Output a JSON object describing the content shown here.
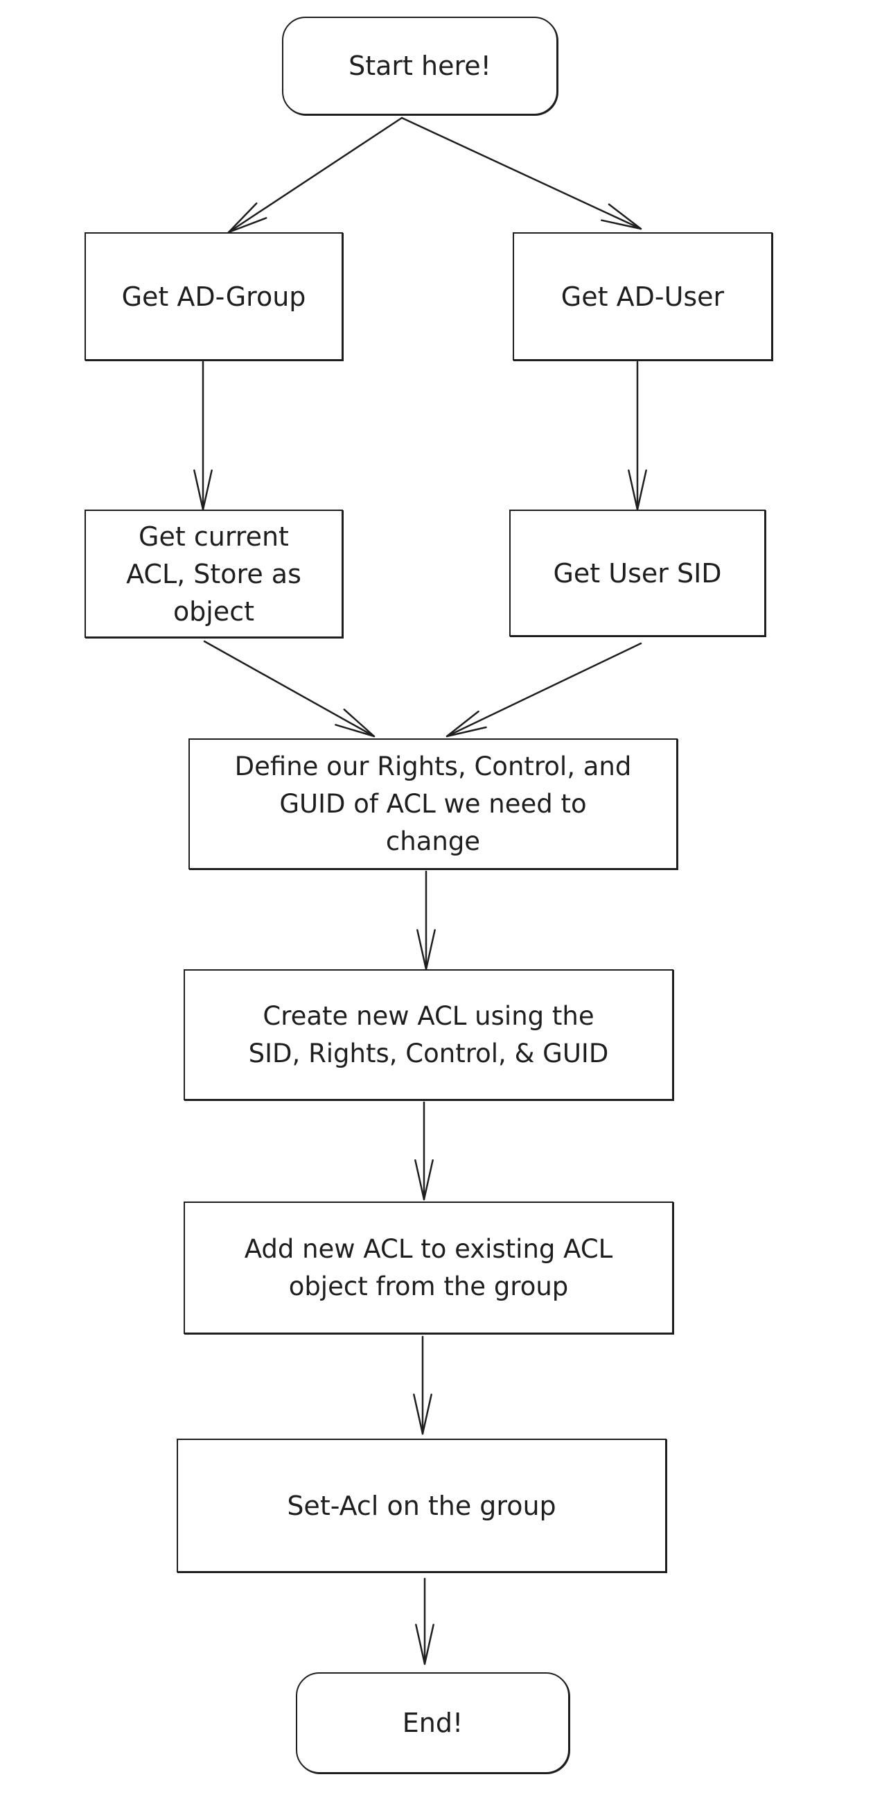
{
  "diagram": {
    "type": "flowchart",
    "style": "hand-drawn",
    "stroke_color": "#1e1e1e",
    "background_color": "#ffffff",
    "nodes": [
      {
        "id": "start",
        "shape": "rounded-rectangle",
        "label": "Start here!"
      },
      {
        "id": "group",
        "shape": "rectangle",
        "label": "Get AD-Group"
      },
      {
        "id": "user",
        "shape": "rectangle",
        "label": "Get AD-User"
      },
      {
        "id": "acl",
        "shape": "rectangle",
        "label": "Get current\nACL, Store as\nobject"
      },
      {
        "id": "sid",
        "shape": "rectangle",
        "label": "Get User SID"
      },
      {
        "id": "define",
        "shape": "rectangle",
        "label": "Define our Rights, Control, and\nGUID of ACL we need to\nchange"
      },
      {
        "id": "create",
        "shape": "rectangle",
        "label": "Create new ACL using the\nSID, Rights, Control, & GUID"
      },
      {
        "id": "add",
        "shape": "rectangle",
        "label": "Add new ACL to existing ACL\nobject from the group"
      },
      {
        "id": "set",
        "shape": "rectangle",
        "label": "Set-Acl on the group"
      },
      {
        "id": "end",
        "shape": "rounded-rectangle",
        "label": "End!"
      }
    ],
    "edges": [
      {
        "from": "start",
        "to": "group"
      },
      {
        "from": "start",
        "to": "user"
      },
      {
        "from": "group",
        "to": "acl"
      },
      {
        "from": "user",
        "to": "sid"
      },
      {
        "from": "acl",
        "to": "define"
      },
      {
        "from": "sid",
        "to": "define"
      },
      {
        "from": "define",
        "to": "create"
      },
      {
        "from": "create",
        "to": "add"
      },
      {
        "from": "add",
        "to": "set"
      },
      {
        "from": "set",
        "to": "end"
      }
    ]
  }
}
